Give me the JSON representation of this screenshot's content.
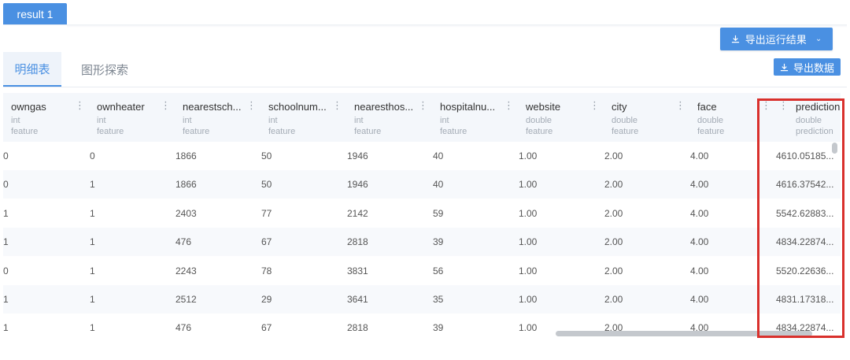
{
  "result_tab": "result 1",
  "toolbar": {
    "export_run_label": "导出运行结果",
    "export_data_label": "导出数据"
  },
  "view_tabs": [
    "明细表",
    "图形探索"
  ],
  "table": {
    "columns": [
      {
        "name": "owngas",
        "type": "int",
        "role": "feature"
      },
      {
        "name": "ownheater",
        "type": "int",
        "role": "feature"
      },
      {
        "name": "nearestsch...",
        "type": "int",
        "role": "feature"
      },
      {
        "name": "schoolnum...",
        "type": "int",
        "role": "feature"
      },
      {
        "name": "nearesthos...",
        "type": "int",
        "role": "feature"
      },
      {
        "name": "hospitalnu...",
        "type": "int",
        "role": "feature"
      },
      {
        "name": "website",
        "type": "double",
        "role": "feature"
      },
      {
        "name": "city",
        "type": "double",
        "role": "feature"
      },
      {
        "name": "face",
        "type": "double",
        "role": "feature"
      },
      {
        "name": "prediction",
        "type": "double",
        "role": "prediction"
      }
    ],
    "rows": [
      [
        "0",
        "0",
        "1866",
        "50",
        "1946",
        "40",
        "1.00",
        "2.00",
        "4.00",
        "4610.05185..."
      ],
      [
        "0",
        "1",
        "1866",
        "50",
        "1946",
        "40",
        "1.00",
        "2.00",
        "4.00",
        "4616.37542..."
      ],
      [
        "1",
        "1",
        "2403",
        "77",
        "2142",
        "59",
        "1.00",
        "2.00",
        "4.00",
        "5542.62883..."
      ],
      [
        "1",
        "1",
        "476",
        "67",
        "2818",
        "39",
        "1.00",
        "2.00",
        "4.00",
        "4834.22874..."
      ],
      [
        "0",
        "1",
        "2243",
        "78",
        "3831",
        "56",
        "1.00",
        "2.00",
        "4.00",
        "5520.22636..."
      ],
      [
        "1",
        "1",
        "2512",
        "29",
        "3641",
        "35",
        "1.00",
        "2.00",
        "4.00",
        "4831.17318..."
      ],
      [
        "1",
        "1",
        "476",
        "67",
        "2818",
        "39",
        "1.00",
        "2.00",
        "4.00",
        "4834.22874..."
      ]
    ]
  },
  "colors": {
    "accent": "#4a90e2",
    "highlight": "#d9302c"
  },
  "icons": [
    "download-icon",
    "chevron-down-icon",
    "column-menu-icon"
  ]
}
